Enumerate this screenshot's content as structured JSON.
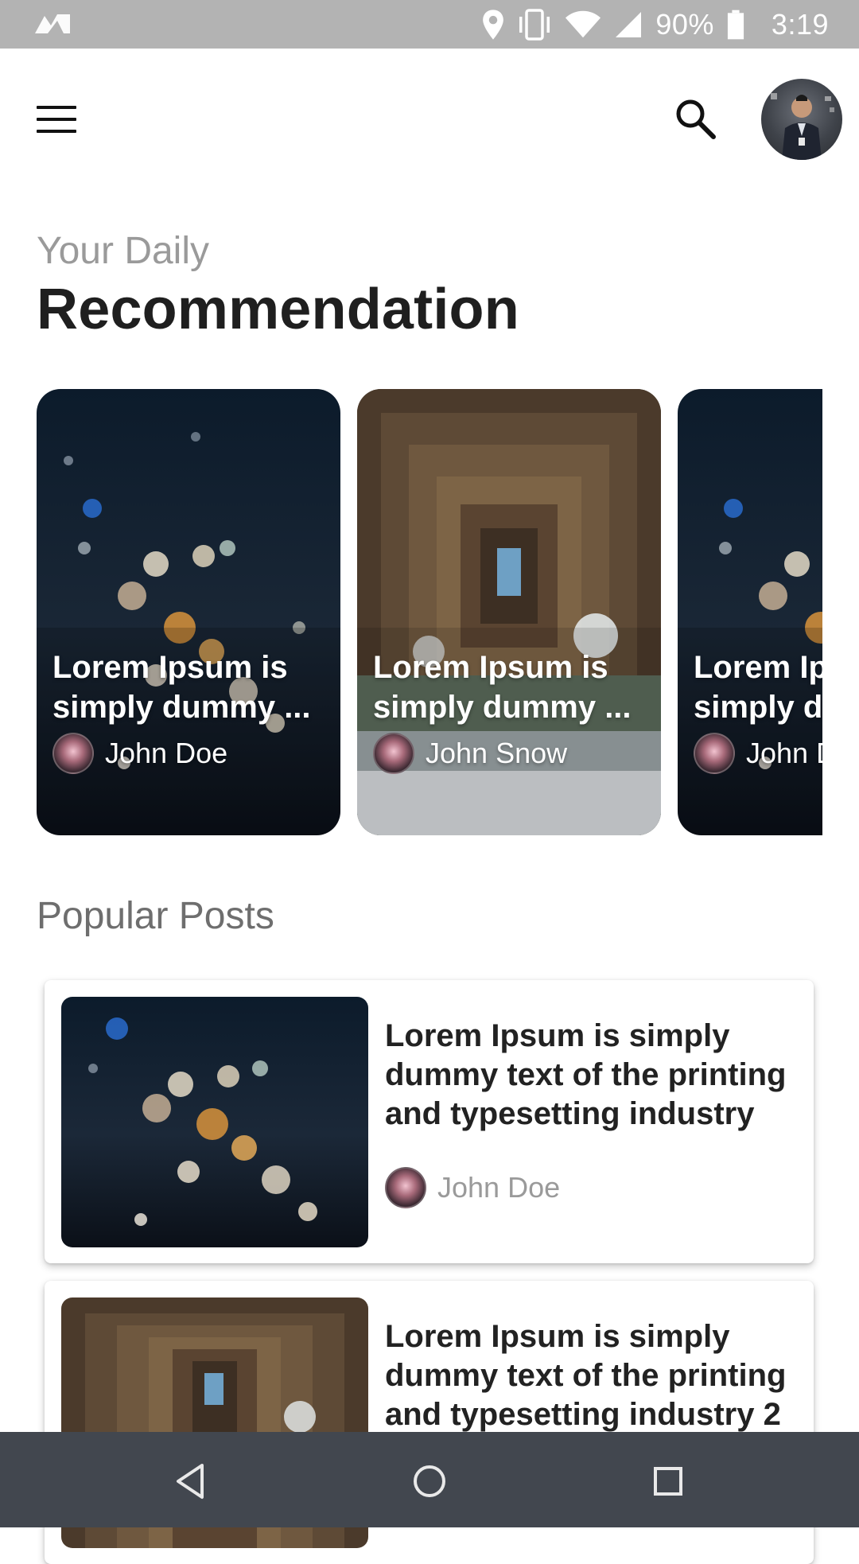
{
  "status_bar": {
    "battery": "90%",
    "time": "3:19",
    "icons": [
      "app-notification-icon",
      "location-icon",
      "vibrate-icon",
      "wifi-icon",
      "cell-signal-icon",
      "battery-icon"
    ]
  },
  "app_bar": {
    "icons": [
      "menu-icon",
      "search-icon",
      "profile-avatar"
    ]
  },
  "header": {
    "eyebrow": "Your Daily",
    "title": "Recommendation"
  },
  "recommendations": [
    {
      "title": "Lorem Ipsum is simply dummy ...",
      "author": "John Doe",
      "image": "city-bokeh"
    },
    {
      "title": "Lorem Ipsum is simply dummy ...",
      "author": "John Snow",
      "image": "pier-underside"
    },
    {
      "title": "Lorem Ipsum is simply dummy ...",
      "author": "John Doe",
      "image": "city-bokeh"
    }
  ],
  "popular": {
    "title": "Popular Posts",
    "posts": [
      {
        "title": "Lorem Ipsum is simply dummy text of the printing and typesetting industry",
        "author": "John Doe",
        "image": "city-bokeh"
      },
      {
        "title": "Lorem Ipsum is simply dummy text of the printing and typesetting industry 2",
        "author": "",
        "image": "pier-underside"
      }
    ]
  },
  "nav_bar": {
    "icons": [
      "back-icon",
      "home-icon",
      "recents-icon"
    ]
  },
  "colors": {
    "status_bar": "#b3b3b3",
    "nav_bar": "#42474f",
    "heading": "#1f1f1f",
    "muted": "#9a9a9a"
  }
}
